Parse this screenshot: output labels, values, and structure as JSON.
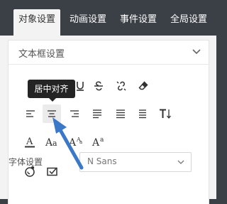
{
  "tabs": [
    {
      "label": "对象设置",
      "active": true
    },
    {
      "label": "动画设置",
      "active": false
    },
    {
      "label": "事件设置",
      "active": false
    },
    {
      "label": "全局设置",
      "active": false
    }
  ],
  "section": {
    "title": "文本框设置"
  },
  "tooltip": {
    "text": "居中对齐"
  },
  "font_setting": {
    "label": "字体设置",
    "value": "N Sans"
  },
  "icons": {
    "row1": [
      "underline-icon",
      "strikethrough-icon",
      "unlink-icon",
      "eraser-icon"
    ],
    "row2": [
      "align-left-icon",
      "align-center-icon",
      "align-right-icon",
      "align-justify-icon",
      "justify-all-icon",
      "distribute-icon",
      "text-height-icon"
    ],
    "row3": [
      "font-color-icon",
      "font-size-icon",
      "superscript-icon",
      "subscript-icon"
    ],
    "row4": [
      "emoji-icon",
      "message-icon"
    ]
  },
  "colors": {
    "arrow": "#3c78c8",
    "tooltip_bg": "#242424",
    "tab_bar": "#3b3f46"
  }
}
